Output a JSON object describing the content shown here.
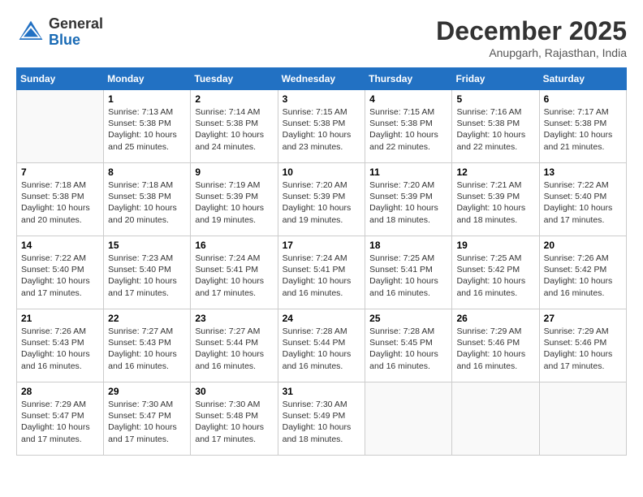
{
  "header": {
    "logo_general": "General",
    "logo_blue": "Blue",
    "month_year": "December 2025",
    "location": "Anupgarh, Rajasthan, India"
  },
  "days_of_week": [
    "Sunday",
    "Monday",
    "Tuesday",
    "Wednesday",
    "Thursday",
    "Friday",
    "Saturday"
  ],
  "weeks": [
    [
      {
        "day": "",
        "info": ""
      },
      {
        "day": "1",
        "info": "Sunrise: 7:13 AM\nSunset: 5:38 PM\nDaylight: 10 hours\nand 25 minutes."
      },
      {
        "day": "2",
        "info": "Sunrise: 7:14 AM\nSunset: 5:38 PM\nDaylight: 10 hours\nand 24 minutes."
      },
      {
        "day": "3",
        "info": "Sunrise: 7:15 AM\nSunset: 5:38 PM\nDaylight: 10 hours\nand 23 minutes."
      },
      {
        "day": "4",
        "info": "Sunrise: 7:15 AM\nSunset: 5:38 PM\nDaylight: 10 hours\nand 22 minutes."
      },
      {
        "day": "5",
        "info": "Sunrise: 7:16 AM\nSunset: 5:38 PM\nDaylight: 10 hours\nand 22 minutes."
      },
      {
        "day": "6",
        "info": "Sunrise: 7:17 AM\nSunset: 5:38 PM\nDaylight: 10 hours\nand 21 minutes."
      }
    ],
    [
      {
        "day": "7",
        "info": "Sunrise: 7:18 AM\nSunset: 5:38 PM\nDaylight: 10 hours\nand 20 minutes."
      },
      {
        "day": "8",
        "info": "Sunrise: 7:18 AM\nSunset: 5:38 PM\nDaylight: 10 hours\nand 20 minutes."
      },
      {
        "day": "9",
        "info": "Sunrise: 7:19 AM\nSunset: 5:39 PM\nDaylight: 10 hours\nand 19 minutes."
      },
      {
        "day": "10",
        "info": "Sunrise: 7:20 AM\nSunset: 5:39 PM\nDaylight: 10 hours\nand 19 minutes."
      },
      {
        "day": "11",
        "info": "Sunrise: 7:20 AM\nSunset: 5:39 PM\nDaylight: 10 hours\nand 18 minutes."
      },
      {
        "day": "12",
        "info": "Sunrise: 7:21 AM\nSunset: 5:39 PM\nDaylight: 10 hours\nand 18 minutes."
      },
      {
        "day": "13",
        "info": "Sunrise: 7:22 AM\nSunset: 5:40 PM\nDaylight: 10 hours\nand 17 minutes."
      }
    ],
    [
      {
        "day": "14",
        "info": "Sunrise: 7:22 AM\nSunset: 5:40 PM\nDaylight: 10 hours\nand 17 minutes."
      },
      {
        "day": "15",
        "info": "Sunrise: 7:23 AM\nSunset: 5:40 PM\nDaylight: 10 hours\nand 17 minutes."
      },
      {
        "day": "16",
        "info": "Sunrise: 7:24 AM\nSunset: 5:41 PM\nDaylight: 10 hours\nand 17 minutes."
      },
      {
        "day": "17",
        "info": "Sunrise: 7:24 AM\nSunset: 5:41 PM\nDaylight: 10 hours\nand 16 minutes."
      },
      {
        "day": "18",
        "info": "Sunrise: 7:25 AM\nSunset: 5:41 PM\nDaylight: 10 hours\nand 16 minutes."
      },
      {
        "day": "19",
        "info": "Sunrise: 7:25 AM\nSunset: 5:42 PM\nDaylight: 10 hours\nand 16 minutes."
      },
      {
        "day": "20",
        "info": "Sunrise: 7:26 AM\nSunset: 5:42 PM\nDaylight: 10 hours\nand 16 minutes."
      }
    ],
    [
      {
        "day": "21",
        "info": "Sunrise: 7:26 AM\nSunset: 5:43 PM\nDaylight: 10 hours\nand 16 minutes."
      },
      {
        "day": "22",
        "info": "Sunrise: 7:27 AM\nSunset: 5:43 PM\nDaylight: 10 hours\nand 16 minutes."
      },
      {
        "day": "23",
        "info": "Sunrise: 7:27 AM\nSunset: 5:44 PM\nDaylight: 10 hours\nand 16 minutes."
      },
      {
        "day": "24",
        "info": "Sunrise: 7:28 AM\nSunset: 5:44 PM\nDaylight: 10 hours\nand 16 minutes."
      },
      {
        "day": "25",
        "info": "Sunrise: 7:28 AM\nSunset: 5:45 PM\nDaylight: 10 hours\nand 16 minutes."
      },
      {
        "day": "26",
        "info": "Sunrise: 7:29 AM\nSunset: 5:46 PM\nDaylight: 10 hours\nand 16 minutes."
      },
      {
        "day": "27",
        "info": "Sunrise: 7:29 AM\nSunset: 5:46 PM\nDaylight: 10 hours\nand 17 minutes."
      }
    ],
    [
      {
        "day": "28",
        "info": "Sunrise: 7:29 AM\nSunset: 5:47 PM\nDaylight: 10 hours\nand 17 minutes."
      },
      {
        "day": "29",
        "info": "Sunrise: 7:30 AM\nSunset: 5:47 PM\nDaylight: 10 hours\nand 17 minutes."
      },
      {
        "day": "30",
        "info": "Sunrise: 7:30 AM\nSunset: 5:48 PM\nDaylight: 10 hours\nand 17 minutes."
      },
      {
        "day": "31",
        "info": "Sunrise: 7:30 AM\nSunset: 5:49 PM\nDaylight: 10 hours\nand 18 minutes."
      },
      {
        "day": "",
        "info": ""
      },
      {
        "day": "",
        "info": ""
      },
      {
        "day": "",
        "info": ""
      }
    ]
  ]
}
